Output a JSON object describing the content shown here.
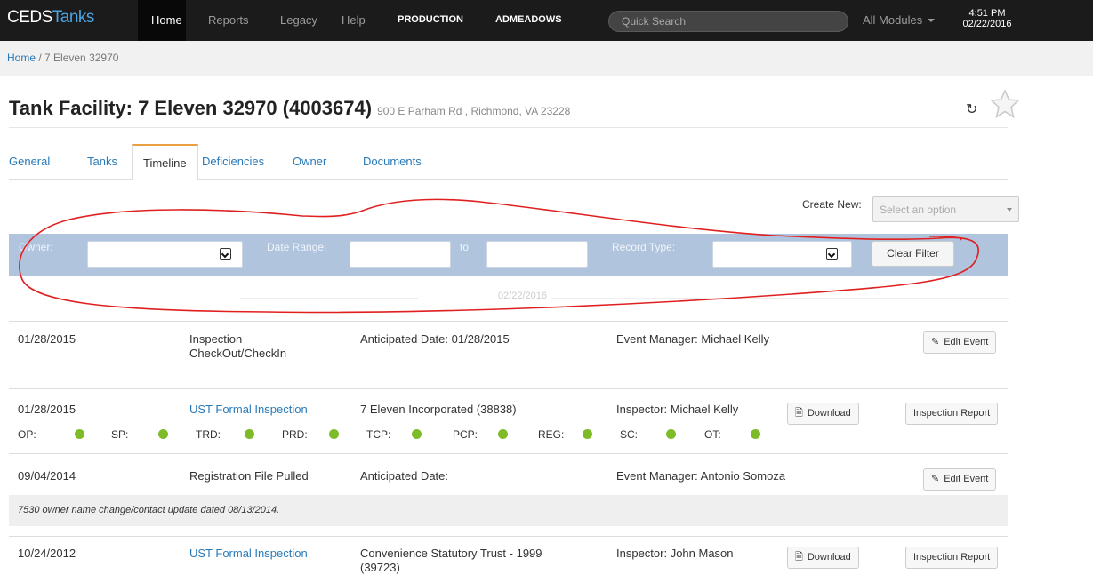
{
  "nav": {
    "brand_a": "CEDS",
    "brand_b": "Tanks",
    "home": "Home",
    "reports": "Reports",
    "legacy": "Legacy",
    "help": "Help",
    "production": "PRODUCTION",
    "user": "ADMEADOWS",
    "search_placeholder": "Quick Search",
    "modules": "All Modules",
    "time": "4:51 PM",
    "date": "02/22/2016"
  },
  "breadcrumb": {
    "home": "Home",
    "sep": " / ",
    "current": "7 Eleven 32970"
  },
  "facility": {
    "title": "Tank Facility: 7 Eleven 32970 (4003674)",
    "address": "900 E Parham Rd , Richmond, VA 23228"
  },
  "tabs": [
    "General",
    "Tanks",
    "Timeline",
    "Deficiencies",
    "Owner",
    "Documents"
  ],
  "create_new": {
    "label": "Create New:",
    "placeholder": "Select an option"
  },
  "filter": {
    "owner": "Owner:",
    "date_range": "Date Range:",
    "to": "to",
    "record_type": "Record Type:",
    "clear": "Clear Filter"
  },
  "today_marker": "02/22/2016",
  "annotation_color": "#e02020",
  "status_color": "#7dbb28",
  "events": [
    {
      "date": "01/28/2015",
      "type": "Inspection CheckOut/CheckIn",
      "detail": "Anticipated Date: 01/28/2015",
      "person": "Event Manager: Michael Kelly",
      "edit": "Edit Event"
    },
    {
      "date": "01/28/2015",
      "type": "UST Formal Inspection",
      "detail": "7 Eleven Incorporated (38838)",
      "person": "Inspector: Michael Kelly",
      "download": "Download",
      "report": "Inspection Report",
      "statuses": [
        "OP:",
        "SP:",
        "TRD:",
        "PRD:",
        "TCP:",
        "PCP:",
        "REG:",
        "SC:",
        "OT:"
      ]
    },
    {
      "date": "09/04/2014",
      "type": "Registration File Pulled",
      "detail": "Anticipated Date:",
      "person": "Event Manager: Antonio Somoza",
      "edit": "Edit Event",
      "note": "7530 owner name change/contact update dated 08/13/2014."
    },
    {
      "date": "10/24/2012",
      "type": "UST Formal Inspection",
      "detail": "Convenience Statutory Trust - 1999 (39723)",
      "person": "Inspector: John Mason",
      "download": "Download",
      "report": "Inspection Report"
    }
  ]
}
